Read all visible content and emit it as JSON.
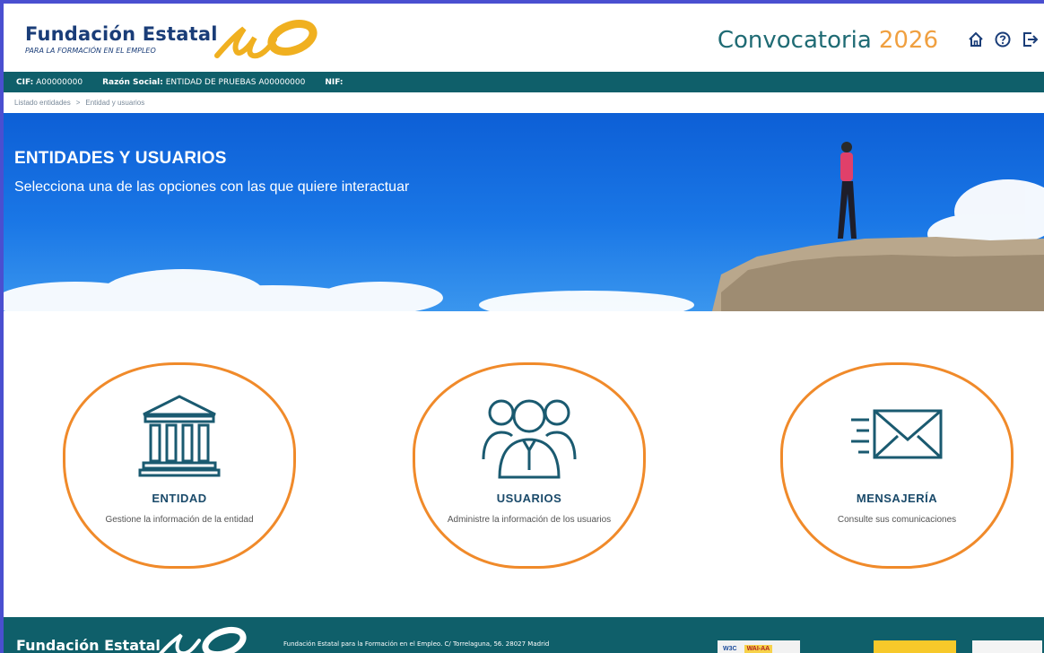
{
  "header": {
    "logo_title": "Fundación Estatal",
    "logo_subtitle": "PARA LA FORMACIÓN EN EL EMPLEO",
    "convocatoria_label": "Convocatoria",
    "convocatoria_year": "2026",
    "icons": [
      "home-icon",
      "help-icon",
      "logout-icon"
    ]
  },
  "infobar": {
    "cif_label": "CIF:",
    "cif_value": "A00000000",
    "razon_label": "Razón Social:",
    "razon_value": "ENTIDAD DE PRUEBAS A00000000",
    "nif_label": "NIF:"
  },
  "breadcrumb": {
    "items": [
      "Listado entidades",
      "Entidad y usuarios"
    ],
    "separator": ">"
  },
  "hero": {
    "title": "ENTIDADES Y USUARIOS",
    "subtitle": "Selecciona una de las opciones con las que quiere interactuar"
  },
  "cards": [
    {
      "title": "ENTIDAD",
      "description": "Gestione la información de la entidad",
      "icon": "building-icon"
    },
    {
      "title": "USUARIOS",
      "description": "Administre la información de los usuarios",
      "icon": "users-icon"
    },
    {
      "title": "MENSAJERÍA",
      "description": "Consulte sus comunicaciones",
      "icon": "mail-icon"
    }
  ],
  "footer": {
    "logo_title": "Fundación Estatal",
    "address": "Fundación Estatal para la Formación en el Empleo. C/ Torrelaguna, 56. 28027 Madrid",
    "w3c_label": "W3C",
    "wai_label": "WAI-AA"
  },
  "colors": {
    "brand_blue": "#1a3d78",
    "teal": "#0f5f6a",
    "orange": "#f08a2a",
    "year_orange": "#f0a040",
    "hero_blue": "#1a77e6"
  }
}
